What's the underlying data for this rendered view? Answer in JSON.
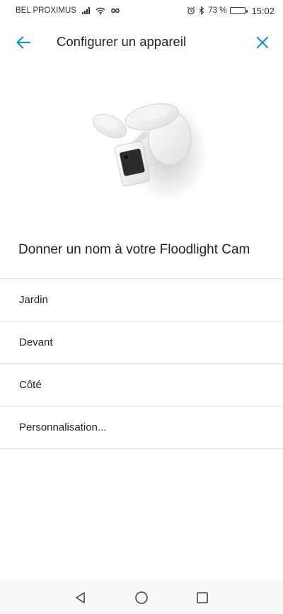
{
  "status_bar": {
    "carrier": "BEL PROXIMUS",
    "battery_percent": "73 %",
    "battery_level": 0.73,
    "time": "15:02"
  },
  "header": {
    "title": "Configurer un appareil",
    "back_icon": "arrow-left-icon",
    "close_icon": "close-icon",
    "accent_color": "#1a8fc9"
  },
  "section": {
    "title": "Donner un nom à votre Floodlight Cam"
  },
  "options": [
    {
      "label": "Jardin"
    },
    {
      "label": "Devant"
    },
    {
      "label": "Côté"
    },
    {
      "label": "Personnalisation..."
    }
  ],
  "nav_bar": {
    "back_icon": "triangle-back-icon",
    "home_icon": "circle-home-icon",
    "recents_icon": "square-recents-icon"
  }
}
